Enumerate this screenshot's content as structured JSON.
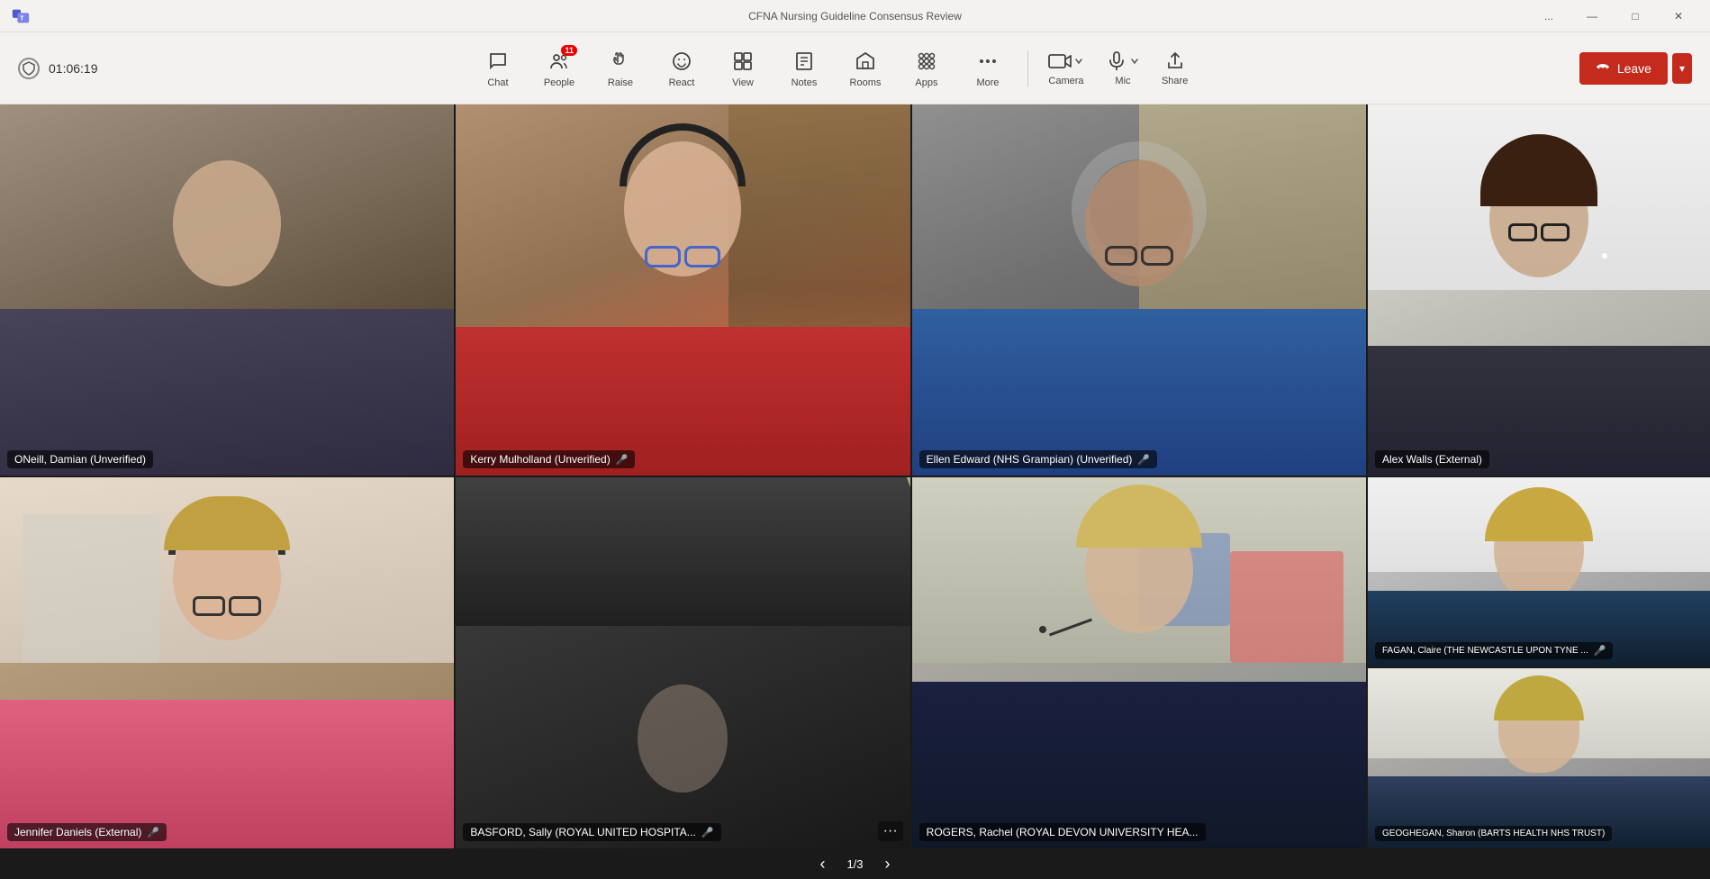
{
  "titleBar": {
    "title": "CFNA Nursing Guideline Consensus Review",
    "controls": {
      "dots": "...",
      "minimize": "—",
      "maximize": "□",
      "close": "✕"
    }
  },
  "toolbar": {
    "timer": "01:06:19",
    "items": [
      {
        "id": "chat",
        "label": "Chat",
        "icon": "chat"
      },
      {
        "id": "people",
        "label": "People",
        "icon": "people",
        "badge": "11"
      },
      {
        "id": "raise",
        "label": "Raise",
        "icon": "raise"
      },
      {
        "id": "react",
        "label": "React",
        "icon": "react"
      },
      {
        "id": "view",
        "label": "View",
        "icon": "view"
      },
      {
        "id": "notes",
        "label": "Notes",
        "icon": "notes"
      },
      {
        "id": "rooms",
        "label": "Rooms",
        "icon": "rooms"
      },
      {
        "id": "apps",
        "label": "Apps",
        "icon": "apps"
      },
      {
        "id": "more",
        "label": "More",
        "icon": "more"
      }
    ],
    "camera": {
      "label": "Camera"
    },
    "mic": {
      "label": "Mic"
    },
    "share": {
      "label": "Share"
    },
    "leave": {
      "label": "Leave"
    }
  },
  "participants": [
    {
      "id": "damian",
      "name": "ONeill, Damian (Unverified)",
      "muted": false,
      "row": 0,
      "col": 0
    },
    {
      "id": "kerry",
      "name": "Kerry Mulholland (Unverified)",
      "muted": true,
      "row": 0,
      "col": 1
    },
    {
      "id": "ellen",
      "name": "Ellen Edward (NHS Grampian) (Unverified)",
      "muted": true,
      "row": 0,
      "col": 2
    },
    {
      "id": "jennifer",
      "name": "Jennifer Daniels (External)",
      "muted": true,
      "row": 1,
      "col": 0
    },
    {
      "id": "basford",
      "name": "BASFORD, Sally (ROYAL UNITED HOSPITA...",
      "muted": true,
      "row": 1,
      "col": 1
    },
    {
      "id": "rogers",
      "name": "ROGERS, Rachel (ROYAL DEVON UNIVERSITY HEA...",
      "muted": false,
      "row": 1,
      "col": 2
    },
    {
      "id": "alex",
      "name": "Alex Walls (External)",
      "muted": false,
      "panel": "top"
    },
    {
      "id": "fagan",
      "name": "FAGAN, Claire (THE NEWCASTLE UPON TYNE ...",
      "muted": true,
      "panel": "mid"
    },
    {
      "id": "sharon",
      "name": "GEOGHEGAN, Sharon (BARTS HEALTH NHS TRUST)",
      "muted": false,
      "panel": "bottom"
    }
  ],
  "pagination": {
    "current": 1,
    "total": 3,
    "display": "1/3"
  }
}
